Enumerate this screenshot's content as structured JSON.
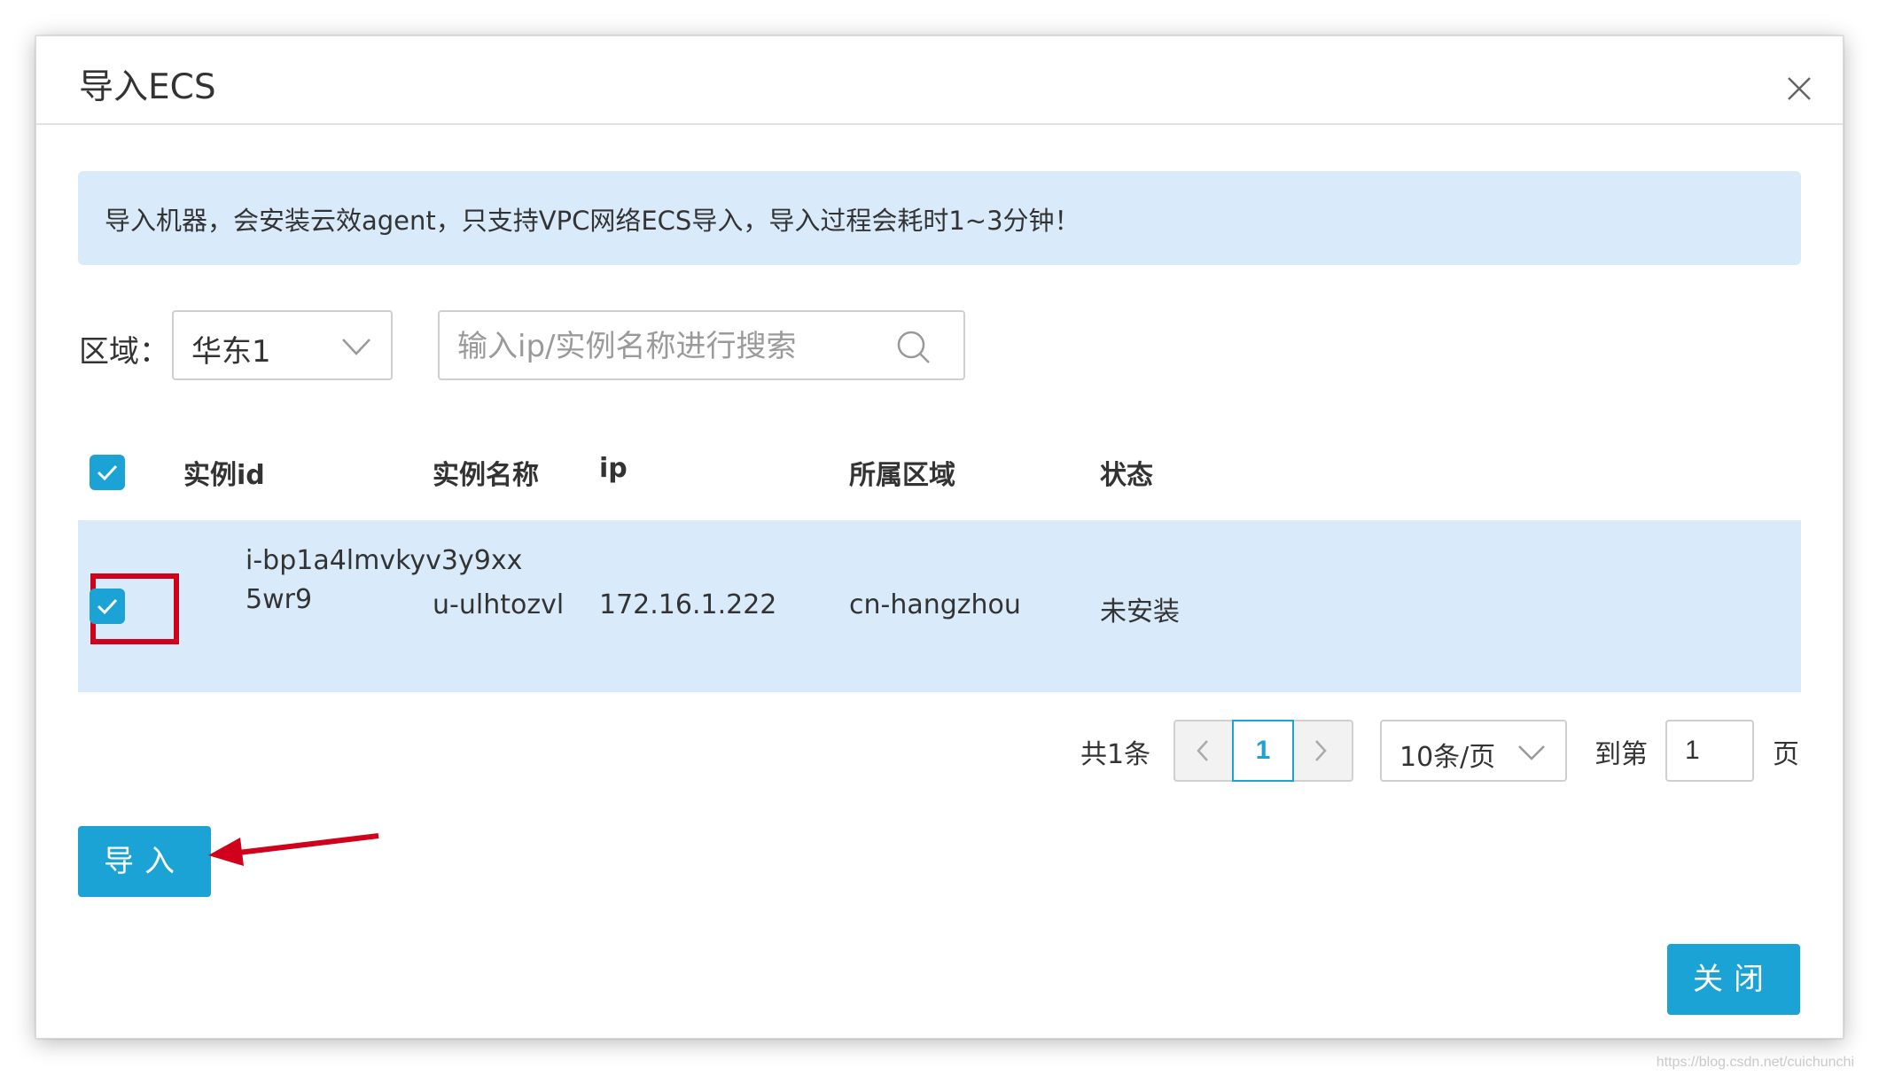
{
  "dialog": {
    "title": "导入ECS",
    "close_icon": "close-icon"
  },
  "notice": {
    "text": "导入机器，会安装云效agent，只支持VPC网络ECS导入，导入过程会耗时1~3分钟！"
  },
  "filter": {
    "region_label": "区域：",
    "region_value": "华东1",
    "search_placeholder": "输入ip/实例名称进行搜索"
  },
  "table": {
    "columns": [
      "实例id",
      "实例名称",
      "ip",
      "所属区域",
      "状态"
    ],
    "rows": [
      {
        "checked": true,
        "id": "i-bp1a4lmvkyv3y9xx5wr9",
        "name": "u-ulhtozvl",
        "ip": "172.16.1.222",
        "region": "cn-hangzhou",
        "status": "未安装"
      }
    ],
    "header_checked": true
  },
  "pagination": {
    "total": "共1条",
    "current_page": "1",
    "page_size": "10条/页",
    "goto_label": "到第",
    "goto_value": "1",
    "page_unit": "页"
  },
  "buttons": {
    "import": "导入",
    "close": "关闭"
  },
  "colors": {
    "accent": "#1ba3d6",
    "notice_bg": "#d9ebfb",
    "annotation": "#d0021b"
  },
  "watermark": "https://blog.csdn.net/cuichunchi"
}
